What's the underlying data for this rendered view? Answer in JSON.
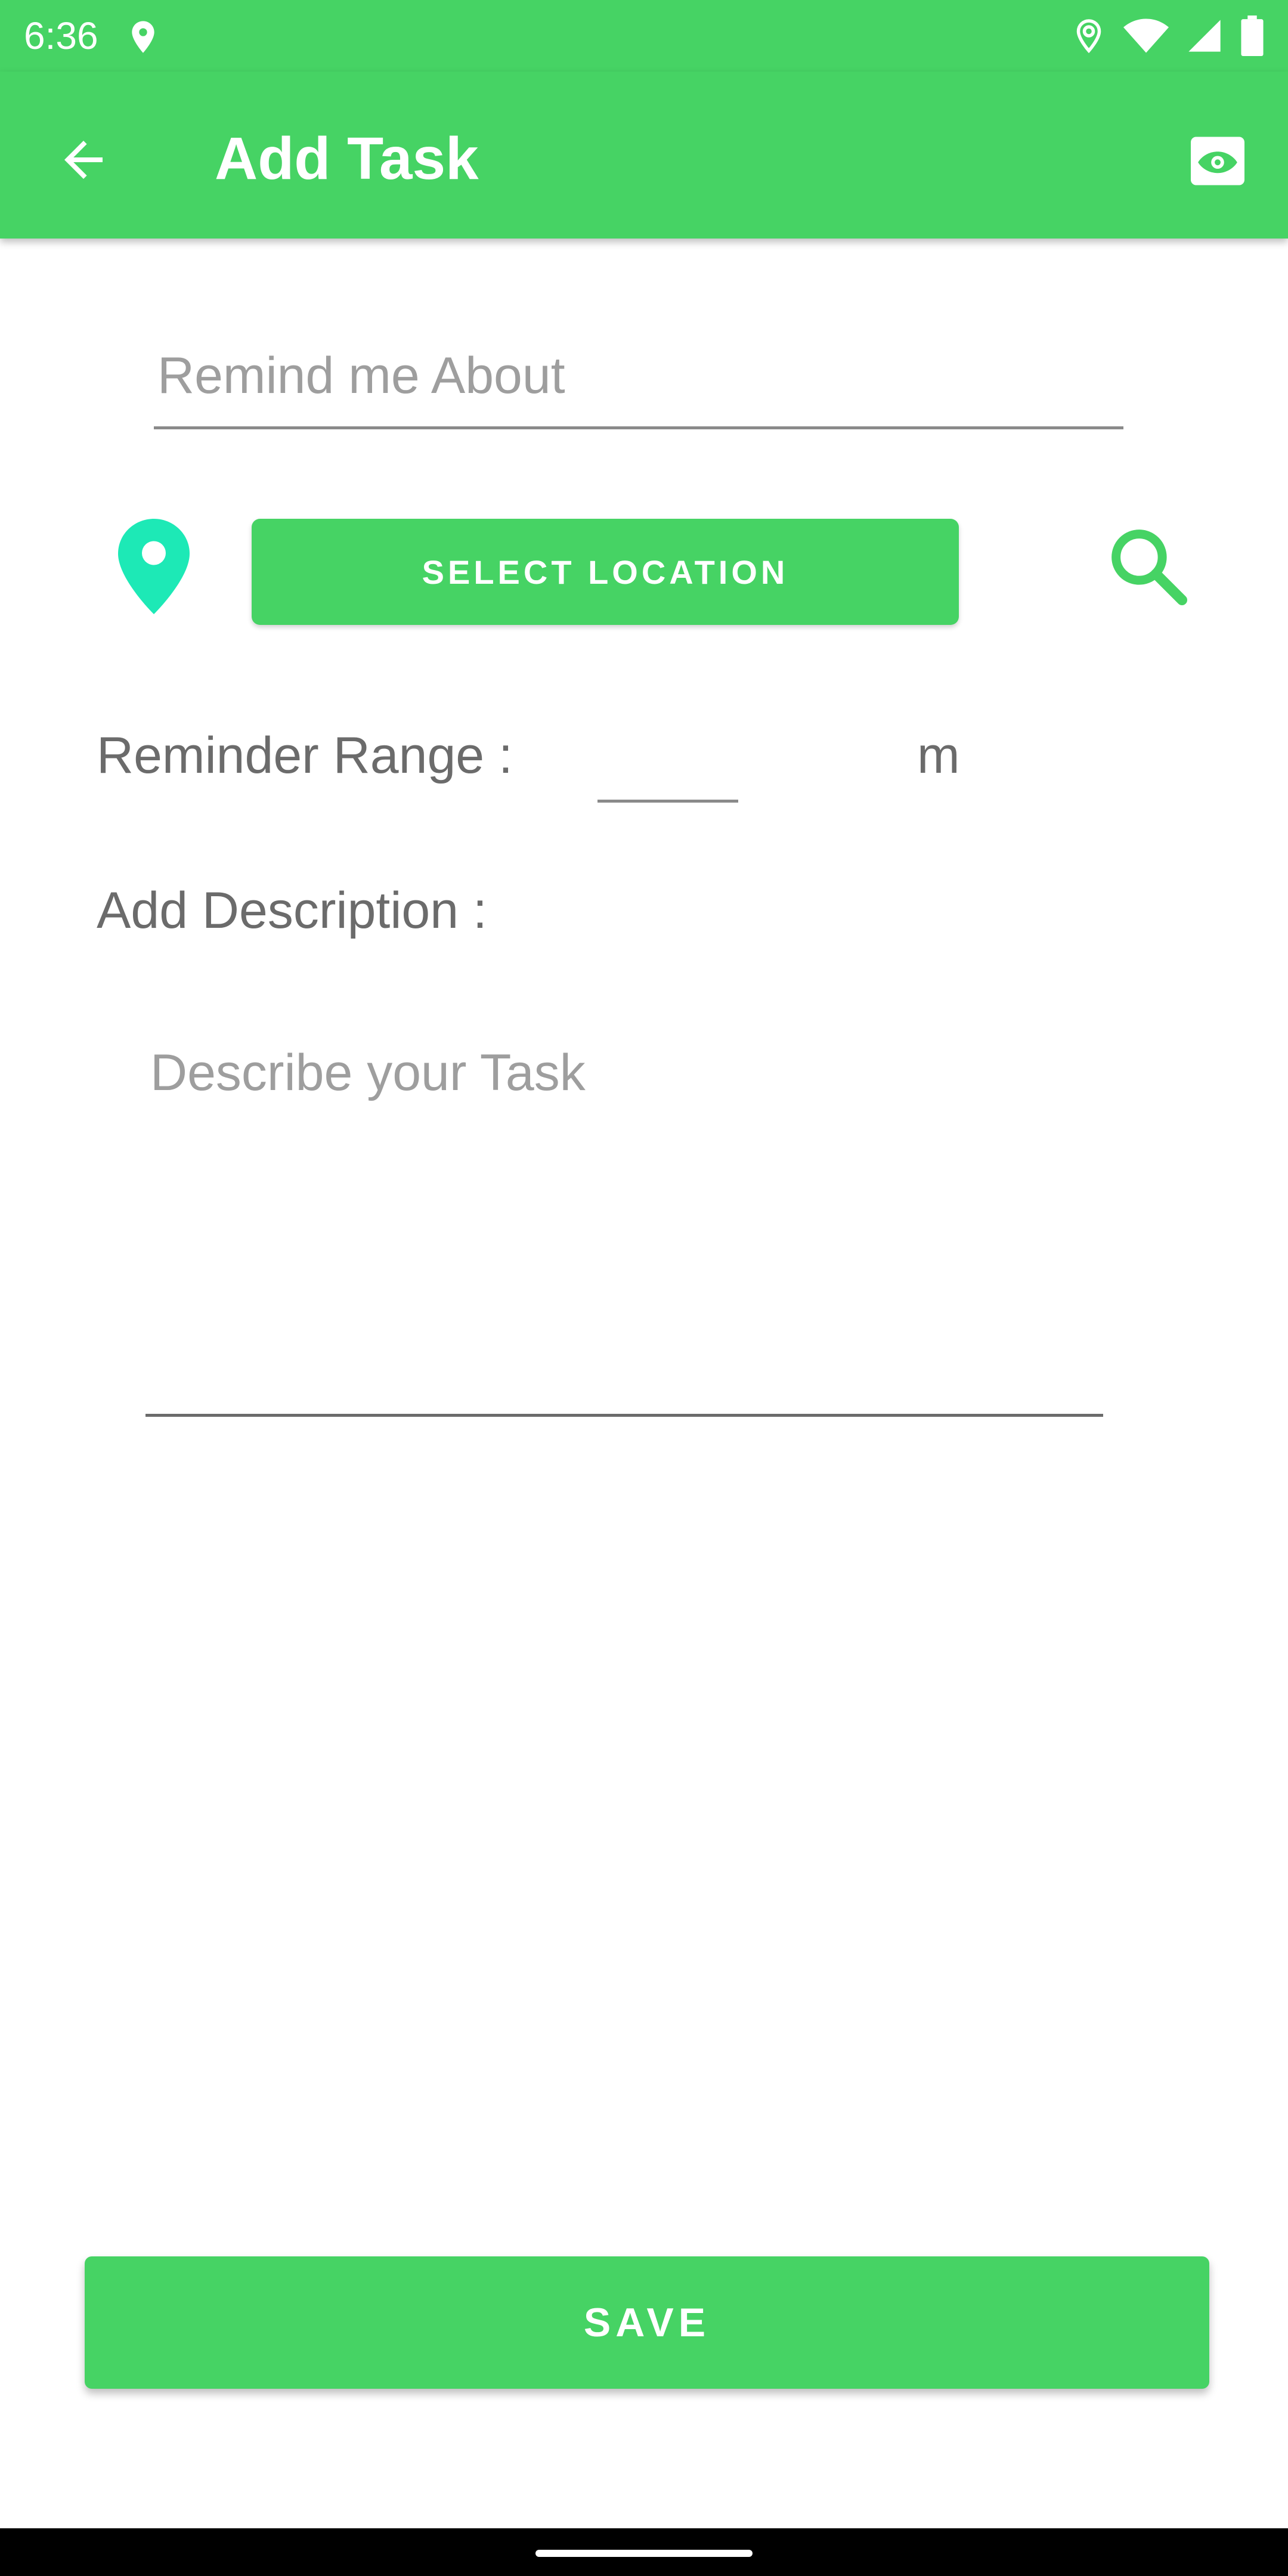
{
  "status_bar": {
    "time": "6:36",
    "icons": [
      "location-icon",
      "location-icon",
      "wifi-icon",
      "signal-icon",
      "battery-icon"
    ]
  },
  "app_bar": {
    "title": "Add Task",
    "back_icon": "arrow-left-icon",
    "preview_icon": "eye-preview-icon"
  },
  "form": {
    "remind_placeholder": "Remind me About",
    "remind_value": "",
    "location_button_label": "SELECT LOCATION",
    "range_label": "Reminder Range :",
    "range_value": "",
    "range_unit": "m",
    "description_label": "Add Description :",
    "description_placeholder": "Describe your Task",
    "description_value": ""
  },
  "actions": {
    "save_label": "SAVE"
  },
  "colors": {
    "primary": "#46d364",
    "pin_accent": "#1de9b6",
    "text_secondary": "#6b6b6b",
    "hint": "#9e9e9e"
  }
}
